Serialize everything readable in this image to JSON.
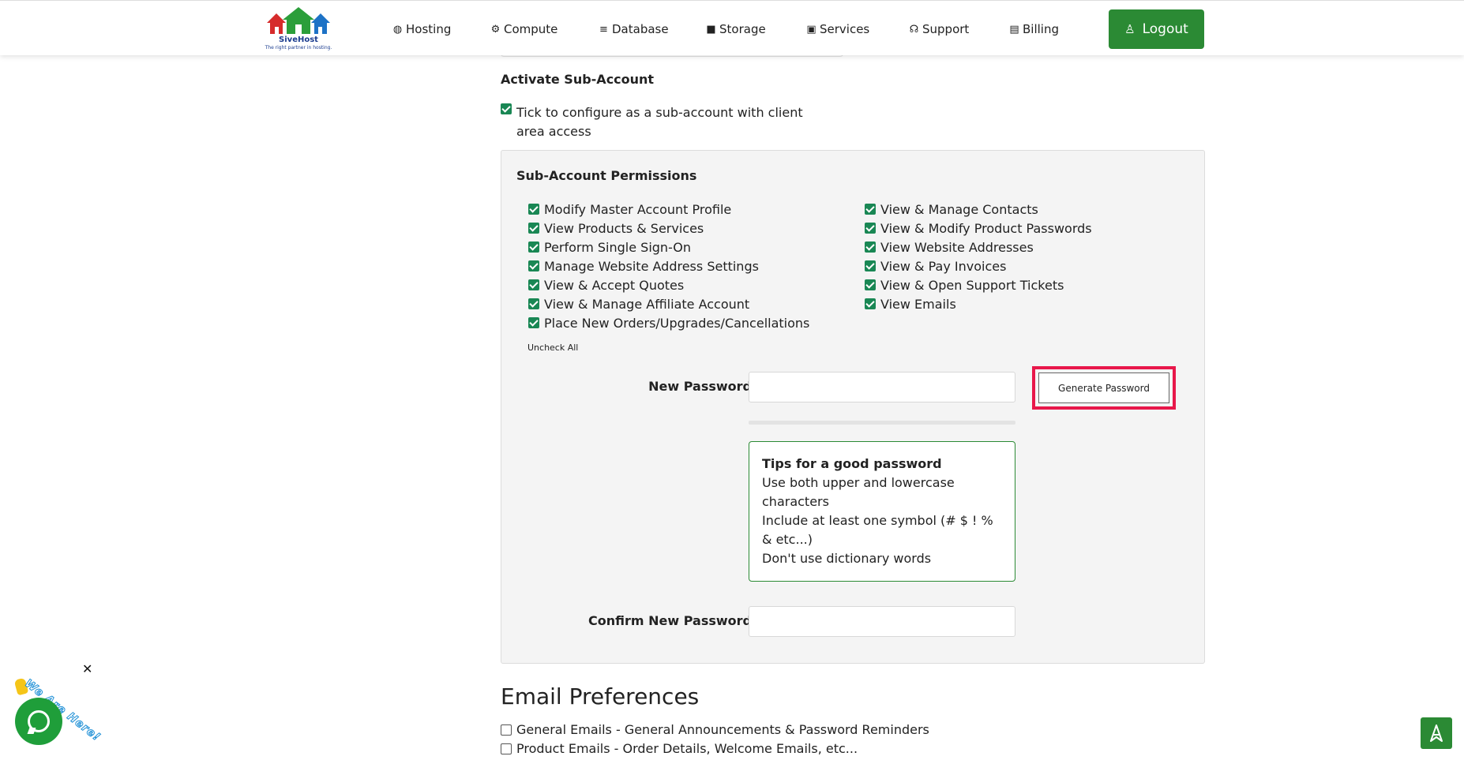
{
  "brand": {
    "name": "SiveHost",
    "tagline": "The right partner in hosting.",
    "colors": {
      "green": "#2b8a34",
      "red": "#d62b2b",
      "blue": "#1d72c6",
      "navy": "#1b3c8f"
    }
  },
  "nav": {
    "items": [
      {
        "label": "Hosting",
        "icon": "globe-icon"
      },
      {
        "label": "Compute",
        "icon": "gear-icon"
      },
      {
        "label": "Database",
        "icon": "database-icon"
      },
      {
        "label": "Storage",
        "icon": "box-icon"
      },
      {
        "label": "Services",
        "icon": "gift-icon"
      },
      {
        "label": "Support",
        "icon": "headset-icon"
      },
      {
        "label": "Billing",
        "icon": "document-icon"
      }
    ],
    "logout_label": "Logout"
  },
  "activate": {
    "title": "Activate Sub-Account",
    "checkbox_label": "Tick to configure as a sub-account with client area access",
    "checked": true
  },
  "permissions": {
    "title": "Sub-Account Permissions",
    "left": [
      "Modify Master Account Profile",
      "View Products & Services",
      "Perform Single Sign-On",
      "Manage Website Address Settings",
      "View & Accept Quotes",
      "View & Manage Affiliate Account",
      "Place New Orders/Upgrades/Cancellations"
    ],
    "right": [
      "View & Manage Contacts",
      "View & Modify Product Passwords",
      "View Website Addresses",
      "View & Pay Invoices",
      "View & Open Support Tickets",
      "View Emails"
    ],
    "uncheck_all_label": "Uncheck All"
  },
  "password": {
    "new_label": "New Password",
    "new_value": "",
    "generate_label": "Generate Password",
    "strength_percent": 0,
    "confirm_label": "Confirm New Password",
    "confirm_value": "",
    "tips": {
      "title": "Tips for a good password",
      "line1": "Use both upper and lowercase characters",
      "line2": "Include at least one symbol (# $ ! % & etc...)",
      "line3": "Don't use dictionary words"
    }
  },
  "email_prefs": {
    "title": "Email Preferences",
    "items": [
      {
        "label": "General Emails - General Announcements & Password Reminders",
        "checked": false
      },
      {
        "label": "Product Emails - Order Details, Welcome Emails, etc...",
        "checked": false
      }
    ]
  },
  "chat": {
    "badge_text": "We Are Here!",
    "close_symbol": "✕"
  }
}
